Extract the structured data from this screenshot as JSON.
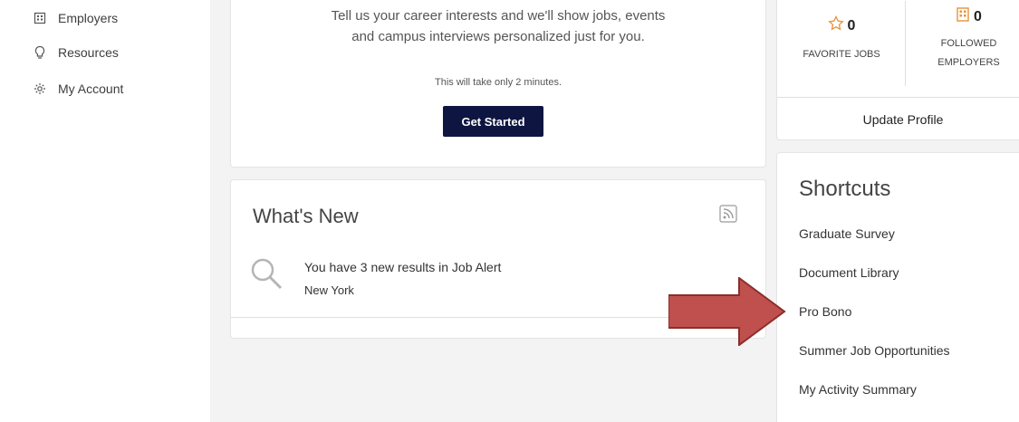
{
  "sidebar": {
    "items": [
      {
        "label": "Employers",
        "icon": "building-icon"
      },
      {
        "label": "Resources",
        "icon": "lightbulb-icon"
      },
      {
        "label": "My Account",
        "icon": "gear-icon"
      }
    ]
  },
  "career": {
    "line1": "Tell us your career interests and we'll show jobs, events",
    "line2": "and campus interviews personalized just for you.",
    "note": "This will take only 2 minutes.",
    "button": "Get Started"
  },
  "whats_new": {
    "title": "What's New",
    "alert_text": "You have 3 new results in Job Alert",
    "alert_location": "New York",
    "icons": [
      "rss-icon",
      "search-icon"
    ]
  },
  "stats": {
    "favorite_count": "0",
    "favorite_label": "FAVORITE JOBS",
    "followed_count": "0",
    "followed_label_1": "FOLLOWED",
    "followed_label_2": "EMPLOYERS",
    "update_profile": "Update Profile",
    "accent_color": "#e8923a"
  },
  "shortcuts": {
    "title": "Shortcuts",
    "items": [
      "Graduate Survey",
      "Document Library",
      "Pro Bono",
      "Summer Job Opportunities",
      "My Activity Summary"
    ]
  },
  "annotation": {
    "arrow_color": "#c0504d",
    "arrow_target": "Pro Bono"
  }
}
